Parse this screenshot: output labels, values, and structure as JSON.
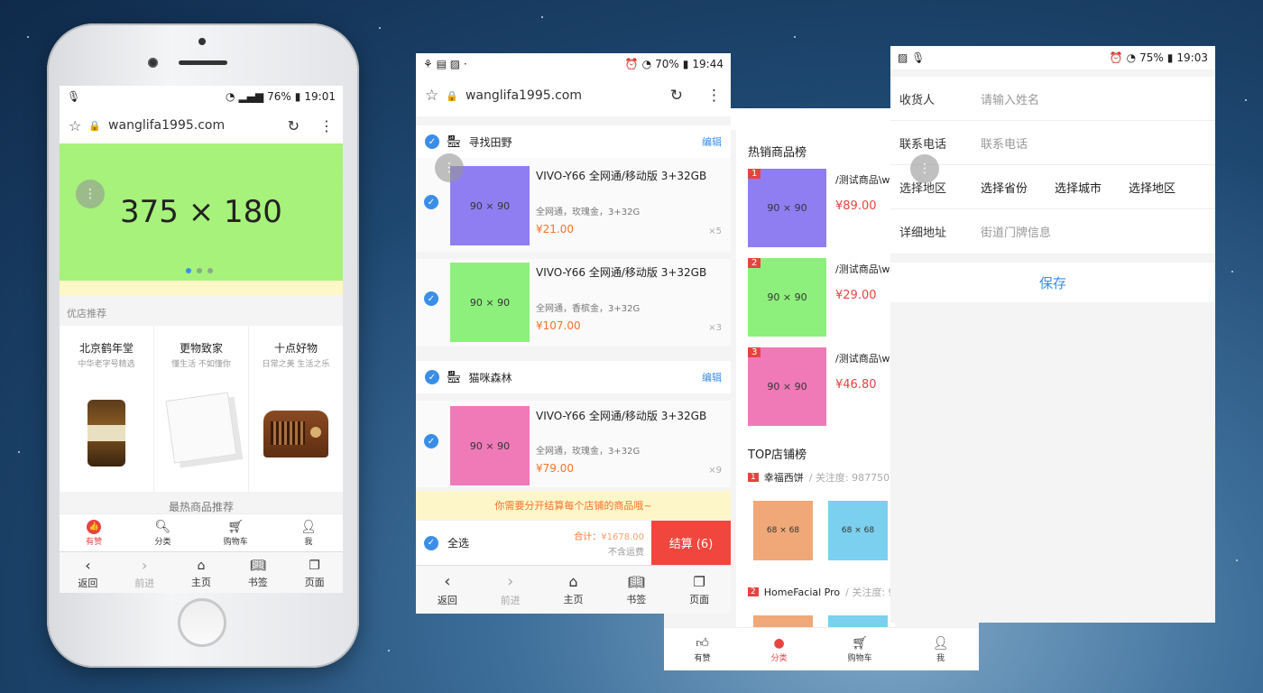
{
  "common": {
    "url": "wanglifa1995.com",
    "nav": {
      "back": "返回",
      "forward": "前进",
      "home": "主页",
      "bookmarks": "书签",
      "pages": "页面"
    },
    "tabs": {
      "like": "有赞",
      "category": "分类",
      "cart": "购物车",
      "me": "我"
    }
  },
  "phone1": {
    "status_right": "76%",
    "time": "19:01",
    "banner_text": "375 × 180",
    "section_title": "优店推荐",
    "shops": [
      {
        "name": "北京鹤年堂",
        "sub": "中华老字号精选"
      },
      {
        "name": "更物致家",
        "sub": "懂生活 不如懂你"
      },
      {
        "name": "十点好物",
        "sub": "日常之美 生活之乐"
      }
    ],
    "hot_title": "最热商品推荐"
  },
  "phone2": {
    "battery": "70%",
    "time": "19:44",
    "edit_label": "编辑",
    "stores": [
      {
        "name": "寻找田野"
      },
      {
        "name": "猫咪森林"
      }
    ],
    "items": [
      {
        "title": "VIVO-Y66 全网通/移动版 3+32GB",
        "spec": "全网通，玫瑰金，3+32G",
        "price": "¥21.00",
        "qty": "×5",
        "ph": "90 × 90",
        "color": "#8f7ef2"
      },
      {
        "title": "VIVO-Y66 全网通/移动版 3+32GB",
        "spec": "全网通，香槟金，3+32G",
        "price": "¥107.00",
        "qty": "×3",
        "ph": "90 × 90",
        "color": "#8ef07c"
      },
      {
        "title": "VIVO-Y66 全网通/移动版 3+32GB",
        "spec": "全网通，玫瑰金，3+32G",
        "price": "¥79.00",
        "qty": "×9",
        "ph": "90 × 90",
        "color": "#f07ab8"
      }
    ],
    "notice": "你需要分开结算每个店铺的商品哦~",
    "select_all": "全选",
    "total_label": "合计：",
    "total": "¥1678.00",
    "shipping": "不含运费",
    "checkout": "结算 (6)"
  },
  "phone3": {
    "hot_title": "热销商品榜",
    "products": [
      {
        "rank": "1",
        "name": "/测试商品\\w",
        "price": "¥89.00",
        "ph": "90 × 90",
        "color": "#8f7ef2"
      },
      {
        "rank": "2",
        "name": "/测试商品\\w",
        "price": "¥29.00",
        "ph": "90 × 90",
        "color": "#8ef07c"
      },
      {
        "rank": "3",
        "name": "/测试商品\\w",
        "price": "¥46.80",
        "ph": "90 × 90",
        "color": "#f07ab8"
      }
    ],
    "top_title": "TOP店铺榜",
    "top_shops": [
      {
        "rank": "1",
        "name": "幸福西饼",
        "follow": "/ 关注度: 987750"
      },
      {
        "rank": "2",
        "name": "HomeFacial Pro",
        "follow": "/ 关注度: 9"
      }
    ],
    "thumb_ph": "68 × 68"
  },
  "phone4": {
    "battery": "75%",
    "time": "19:03",
    "fields": [
      {
        "label": "收货人",
        "value": "请输入姓名"
      },
      {
        "label": "联系电话",
        "value": "联系电话"
      },
      {
        "label": "选择地区",
        "value": ""
      },
      {
        "label": "详细地址",
        "value": "街道门牌信息"
      }
    ],
    "region": {
      "province": "选择省份",
      "city": "选择城市",
      "district": "选择地区"
    },
    "save": "保存"
  }
}
